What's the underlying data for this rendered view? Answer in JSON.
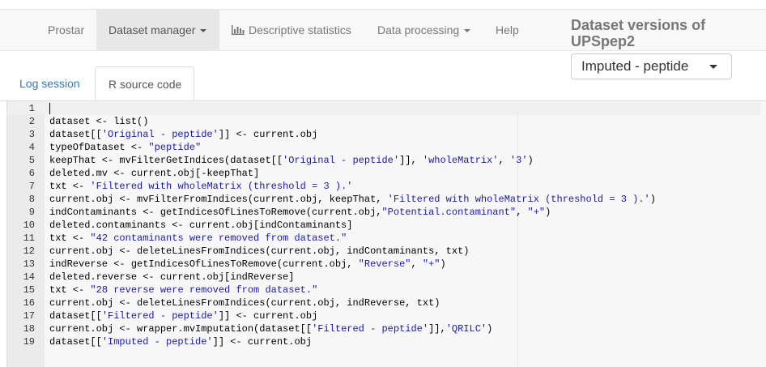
{
  "navbar": {
    "items": [
      {
        "label": "Prostar",
        "dropdown": false
      },
      {
        "label": "Dataset manager",
        "dropdown": true,
        "active": true
      },
      {
        "label": "Descriptive statistics",
        "icon": "bar-chart-icon"
      },
      {
        "label": "Data processing",
        "dropdown": true
      },
      {
        "label": "Help"
      }
    ]
  },
  "dataset_versions": {
    "title": "Dataset versions of UPSpep2",
    "selected": "Imputed - peptide"
  },
  "tabs": {
    "log": "Log session",
    "rsource": "R source code"
  },
  "editor": {
    "lines": [
      {
        "n": "1",
        "text": ""
      },
      {
        "n": "2",
        "text": "dataset <- list()"
      },
      {
        "n": "3",
        "text": "dataset[['Original - peptide']] <- current.obj"
      },
      {
        "n": "4",
        "text": "typeOfDataset <- \"peptide\""
      },
      {
        "n": "5",
        "text": "keepThat <- mvFilterGetIndices(dataset[['Original - peptide']], 'wholeMatrix', '3')"
      },
      {
        "n": "6",
        "text": "deleted.mv <- current.obj[-keepThat]"
      },
      {
        "n": "7",
        "text": "txt <- 'Filtered with wholeMatrix (threshold = 3 ).'"
      },
      {
        "n": "8",
        "text": "current.obj <- mvFilterFromIndices(current.obj, keepThat, 'Filtered with wholeMatrix (threshold = 3 ).')"
      },
      {
        "n": "9",
        "text": "indContaminants <- getIndicesOfLinesToRemove(current.obj,\"Potential.contaminant\", \"+\")"
      },
      {
        "n": "10",
        "text": "deleted.contaminants <- current.obj[indContaminants]"
      },
      {
        "n": "11",
        "text": "txt <- \"42 contaminants were removed from dataset.\""
      },
      {
        "n": "12",
        "text": "current.obj <- deleteLinesFromIndices(current.obj, indContaminants, txt)"
      },
      {
        "n": "13",
        "text": "indReverse <- getIndicesOfLinesToRemove(current.obj, \"Reverse\", \"+\")"
      },
      {
        "n": "14",
        "text": "deleted.reverse <- current.obj[indReverse]"
      },
      {
        "n": "15",
        "text": "txt <- \"28 reverse were removed from dataset.\""
      },
      {
        "n": "16",
        "text": "current.obj <- deleteLinesFromIndices(current.obj, indReverse, txt)"
      },
      {
        "n": "17",
        "text": "dataset[['Filtered - peptide']] <- current.obj"
      },
      {
        "n": "18",
        "text": "current.obj <- wrapper.mvImputation(dataset[['Filtered - peptide']],'QRILC')"
      },
      {
        "n": "19",
        "text": "dataset[['Imputed - peptide']] <- current.obj"
      }
    ]
  },
  "colors": {
    "navbar_bg": "#f8f8f8",
    "active_nav": "#e7e7e7",
    "link": "#337ab7",
    "string": "#1a1aa6"
  }
}
